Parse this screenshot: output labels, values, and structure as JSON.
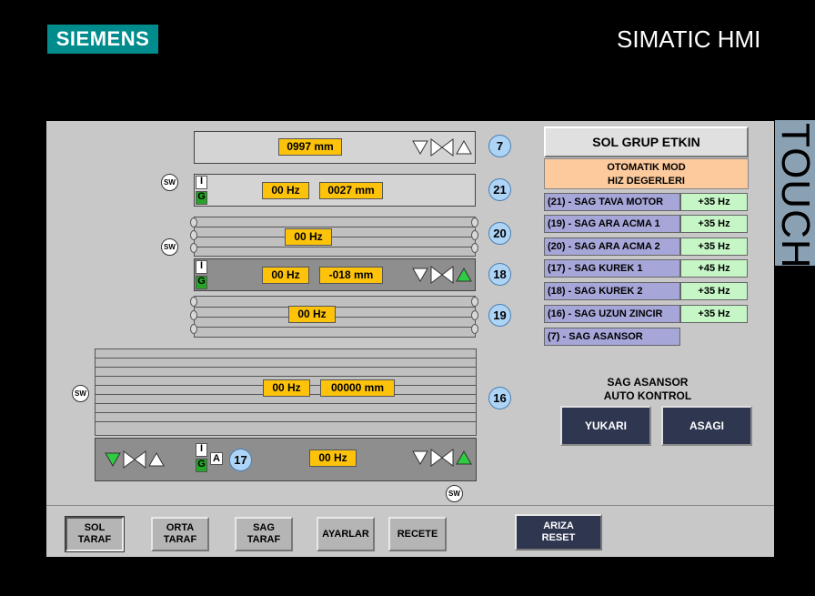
{
  "header": {
    "brand": "SIEMENS",
    "product": "SIMATIC HMI",
    "touch": "TOUCH"
  },
  "lines": {
    "l7": {
      "num": "7",
      "pos": "0997 mm"
    },
    "l21": {
      "num": "21",
      "hz": "00 Hz",
      "pos": "0027 mm",
      "i": "I",
      "g": "G"
    },
    "l20": {
      "num": "20",
      "hz": "00 Hz"
    },
    "l18": {
      "num": "18",
      "hz": "00 Hz",
      "pos": "-018 mm",
      "i": "I",
      "g": "G"
    },
    "l19": {
      "num": "19",
      "hz": "00 Hz"
    },
    "l16": {
      "num": "16",
      "hz": "00 Hz",
      "pos": "00000 mm"
    },
    "l17": {
      "num": "17",
      "hz": "00 Hz",
      "i": "I",
      "g": "G",
      "a": "A"
    }
  },
  "sw": "SW",
  "side": {
    "group_status": "SOL GRUP ETKIN",
    "mode_line1": "OTOMATIK MOD",
    "mode_line2": "HIZ DEGERLERI",
    "speeds": [
      {
        "label": "(21) - SAG TAVA MOTOR",
        "value": "+35 Hz"
      },
      {
        "label": "(19) - SAG ARA ACMA 1",
        "value": "+35 Hz"
      },
      {
        "label": "(20) - SAG ARA ACMA 2",
        "value": "+35 Hz"
      },
      {
        "label": "(17) - SAG KUREK 1",
        "value": "+45 Hz"
      },
      {
        "label": "(18) - SAG KUREK 2",
        "value": "+35 Hz"
      },
      {
        "label": "(16) - SAG UZUN ZINCIR",
        "value": "+35 Hz"
      },
      {
        "label": "(7) - SAG ASANSOR",
        "value": ""
      }
    ],
    "elevator_title1": "SAG ASANSOR",
    "elevator_title2": "AUTO KONTROL",
    "up": "YUKARI",
    "down": "ASAGI"
  },
  "nav": {
    "sol1": "SOL",
    "sol2": "TARAF",
    "orta1": "ORTA",
    "orta2": "TARAF",
    "sag1": "SAG",
    "sag2": "TARAF",
    "ayarlar": "AYARLAR",
    "recete": "RECETE",
    "ariza1": "ARIZA",
    "ariza2": "RESET"
  }
}
